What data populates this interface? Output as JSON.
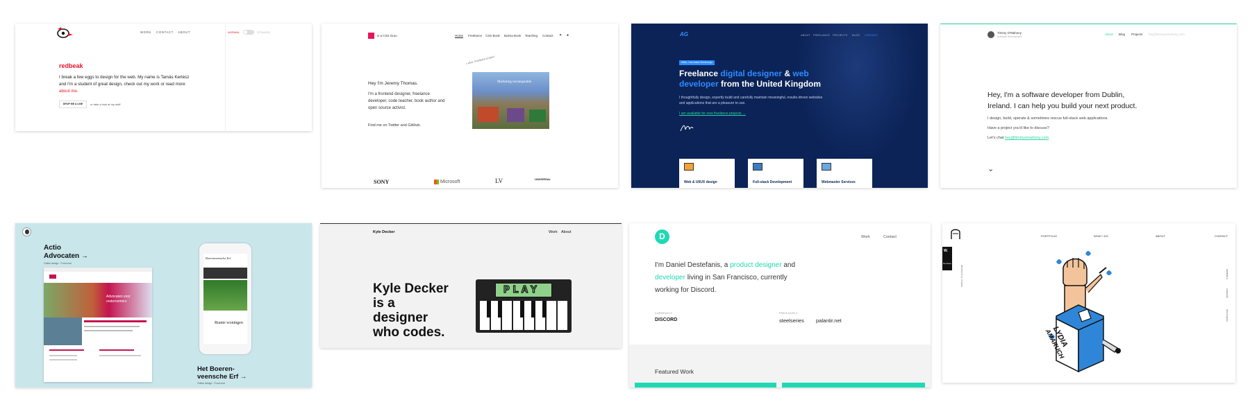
{
  "colors": {
    "red": "#e8132a",
    "navy": "#0b2357",
    "blue": "#2e8bff",
    "teal": "#1ed9b4",
    "mint": "#2bd6a0",
    "light_blue": "#c9e6eb"
  },
  "redbeak": {
    "nav": [
      "WORK",
      "CONTACT",
      "ABOUT"
    ],
    "toggle_left": "NORMAL",
    "toggle_right": "STRANGE",
    "title": "redbeak",
    "intro": "I break a few eggs to design for the web. My name is Tamás Kertész and I'm a student of great design, check out my work or read more",
    "intro_link": "about me.",
    "button": "DROP ME A LINE",
    "side_link": "or take a look at my stuff"
  },
  "css_guru": {
    "logo_text": "is a CSS Guru",
    "nav": [
      "Home",
      "Freelance",
      "CSS Book",
      "Bulma Book",
      "Teaching",
      "Contact"
    ],
    "greeting": "Hey I'm Jeremy Thomas.",
    "bio": "I'm a frontend designer, freelance developer, code teacher, book author and open source activist.",
    "social": "Find me on Twitter and GitHub.",
    "handwritten": "« also: freelance project",
    "image_caption": "Marketing incomparable",
    "clients": [
      "SONY",
      "Microsoft",
      "LV",
      "UNIVERSAL"
    ]
  },
  "ag": {
    "logo": "AG",
    "nav": [
      "ABOUT",
      "FREELANCE",
      "PROJECTS",
      "BLOG",
      "CONTACT"
    ],
    "badge": "Hello, I am Adam Greenough",
    "headline_1": "Freelance ",
    "headline_hl1": "digital designer",
    "headline_2": " & ",
    "headline_hl2": "web developer",
    "headline_3": " from the United Kingdom",
    "body": "I thoughtfully design, expertly build and carefully maintain meaningful, results-driven websites and applications that are a pleasure to use.",
    "link": "I am available for new freelance projects →",
    "services": [
      "Web & UI/UX design",
      "Full-stack Development",
      "Webmaster Services"
    ]
  },
  "tom": {
    "name": "Timmy O'Mahony",
    "subtitle": "Software Development",
    "nav": [
      "About",
      "Blog",
      "Projects"
    ],
    "email": "hey@timmyomahony.com",
    "headline": "Hey, I'm a software developer from Dublin, Ireland. I can help you build your next product.",
    "line1": "I design, build, operate & sometimes rescue full-stack web applications.",
    "line2": "Have a project you'd like to discuss?",
    "line3": "Let's chat",
    "line3_link": "hey@timmyomahony.com",
    "chevron": "⌄"
  },
  "actio": {
    "title_1": "Actio",
    "title_2": "Advocaten →",
    "subtitle": "Online design · Front-end",
    "inner_banner_1": "Advocaten voor",
    "inner_banner_2": "ondernemers",
    "phone_title": "Boerenveensche Erf",
    "phone_caption": "Riante woningen",
    "bottom_1": "Het Boeren-",
    "bottom_2": "veensche Erf →",
    "bottom_sub": "Online design · Front-end"
  },
  "kyle": {
    "name": "Kyle Decker",
    "nav": [
      "Work",
      "About"
    ],
    "headline": "Kyle Decker is a designer who codes.",
    "screen_text": "PLAY"
  },
  "daniel": {
    "logo_letter": "D",
    "nav": [
      "Work",
      "Contact"
    ],
    "p1": "I'm Daniel Destefanis, a ",
    "hl1": "product designer",
    "p2": " and ",
    "hl2": "developer",
    "p3": " living in San Francisco, currently working for Discord.",
    "currently_label": "CURRENTLY",
    "previously_label": "PREVIOUSLY",
    "current_company": "DISCORD",
    "prev_companies": [
      "steelseries",
      "palantir.net"
    ],
    "featured": "Featured Work"
  },
  "lydia": {
    "nav": [
      "PORTFOLIO",
      "WHAT I DO",
      "ABOUT",
      "CONTACT"
    ],
    "side_badge": "W.",
    "side_tag": "Nominee",
    "right_vertical": [
      "DRIBBBLE",
      "LINKEDIN",
      "INSTAGRAM"
    ],
    "left_vertical": "SCROLL TO EXPLORE",
    "box_text_1": "LYDIA",
    "box_text_2": "AMARUCH"
  }
}
